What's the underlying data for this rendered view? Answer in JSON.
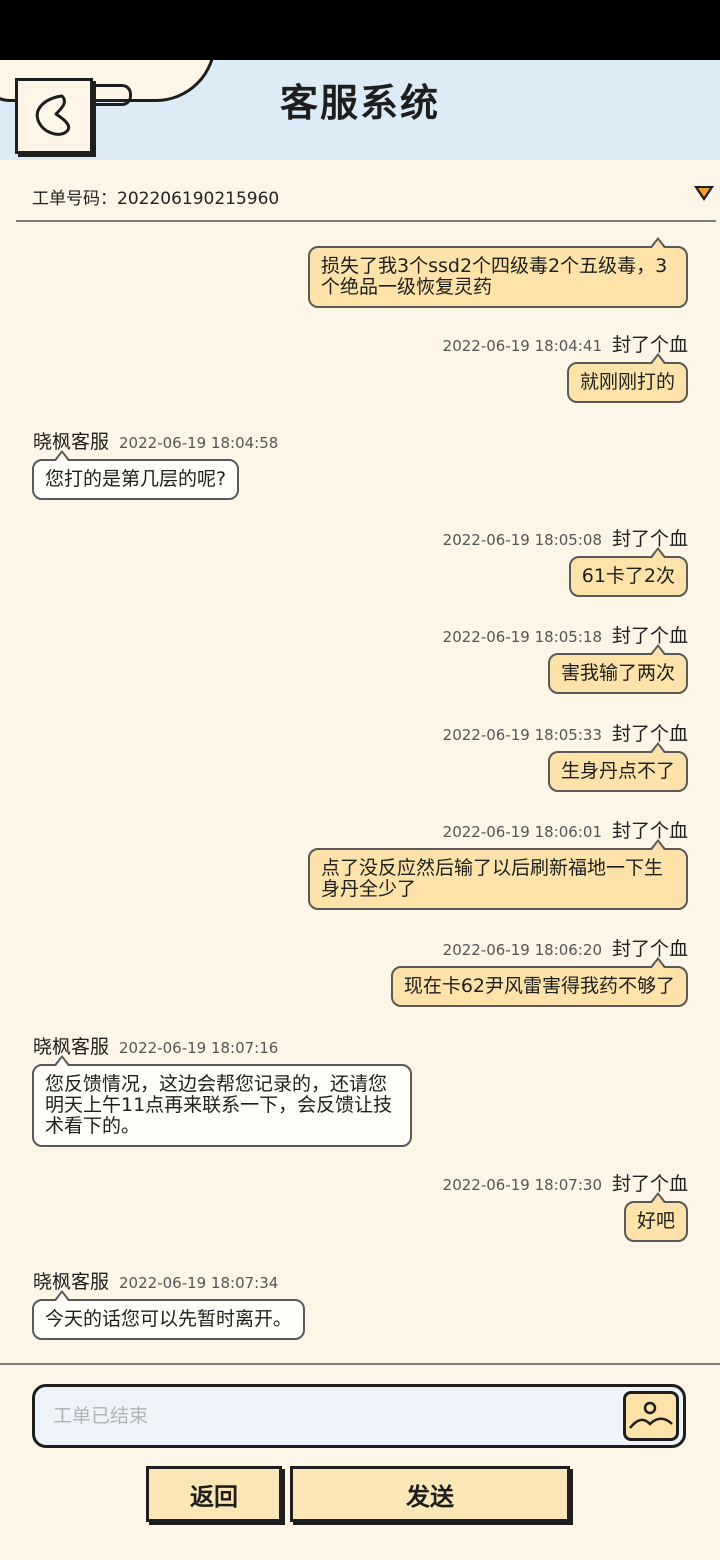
{
  "header": {
    "title": "客服系统"
  },
  "ticket": {
    "label": "工单号码：202206190215960"
  },
  "messages": [
    {
      "side": "mine",
      "text": "损失了我3个ssd2个四级毒2个五级毒，3个绝品一级恢复灵药"
    },
    {
      "side": "mine",
      "time": "2022-06-19 18:04:41",
      "name": "封了个血",
      "text": "就刚刚打的"
    },
    {
      "side": "theirs",
      "time": "2022-06-19 18:04:58",
      "name": "晓枫客服",
      "text": "您打的是第几层的呢?"
    },
    {
      "side": "mine",
      "time": "2022-06-19 18:05:08",
      "name": "封了个血",
      "text": "61卡了2次"
    },
    {
      "side": "mine",
      "time": "2022-06-19 18:05:18",
      "name": "封了个血",
      "text": "害我输了两次"
    },
    {
      "side": "mine",
      "time": "2022-06-19 18:05:33",
      "name": "封了个血",
      "text": "生身丹点不了"
    },
    {
      "side": "mine",
      "time": "2022-06-19 18:06:01",
      "name": "封了个血",
      "text": "点了没反应然后输了以后刷新福地一下生身丹全少了"
    },
    {
      "side": "mine",
      "time": "2022-06-19 18:06:20",
      "name": "封了个血",
      "text": "现在卡62尹风雷害得我药不够了"
    },
    {
      "side": "theirs",
      "time": "2022-06-19 18:07:16",
      "name": "晓枫客服",
      "text": "您反馈情况，这边会帮您记录的，还请您明天上午11点再来联系一下，会反馈让技术看下的。"
    },
    {
      "side": "mine",
      "time": "2022-06-19 18:07:30",
      "name": "封了个血",
      "text": "好吧"
    },
    {
      "side": "theirs",
      "time": "2022-06-19 18:07:34",
      "name": "晓枫客服",
      "text": "今天的话您可以先暂时离开。"
    }
  ],
  "input": {
    "placeholder": "工单已结束"
  },
  "buttons": {
    "back": "返回",
    "send": "发送"
  },
  "icons": {
    "back": "back-swirl-icon",
    "image": "image-icon",
    "toggle": "triangle-down-icon"
  },
  "colors": {
    "header_bg": "#dcecf6",
    "page_bg": "#fdf6e6",
    "mine_bubble": "#fde3a9",
    "theirs_bubble": "#fffdf8",
    "accent": "#f2a22a"
  }
}
